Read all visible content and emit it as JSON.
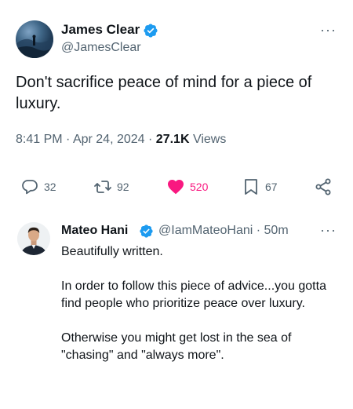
{
  "tweet": {
    "author_name": "James Clear",
    "author_handle": "@JamesClear",
    "text": "Don't sacrifice peace of mind for a piece of luxury.",
    "time": "8:41 PM",
    "date": "Apr 24, 2024",
    "views_count": "27.1K",
    "views_label": "Views",
    "more_label": "···"
  },
  "actions": {
    "replies": "32",
    "reposts": "92",
    "likes": "520",
    "bookmarks": "67"
  },
  "reply": {
    "author_name": "Mateo Hani",
    "author_handle": "@IamMateoHani",
    "time_ago": "50m",
    "paragraphs": [
      "Beautifully written.",
      "In order to follow this piece of advice...you gotta find people who prioritize peace over luxury.",
      "Otherwise you might get lost in the sea of \"chasing\" and \"always more\"."
    ],
    "more_label": "···"
  },
  "colors": {
    "verified": "#1d9bf0",
    "like_active": "#f91880",
    "secondary_text": "#536471",
    "primary_text": "#0f1419"
  },
  "icons": [
    "verified-badge-icon",
    "reply-icon",
    "repost-icon",
    "heart-icon",
    "bookmark-icon",
    "share-icon",
    "more-icon"
  ]
}
